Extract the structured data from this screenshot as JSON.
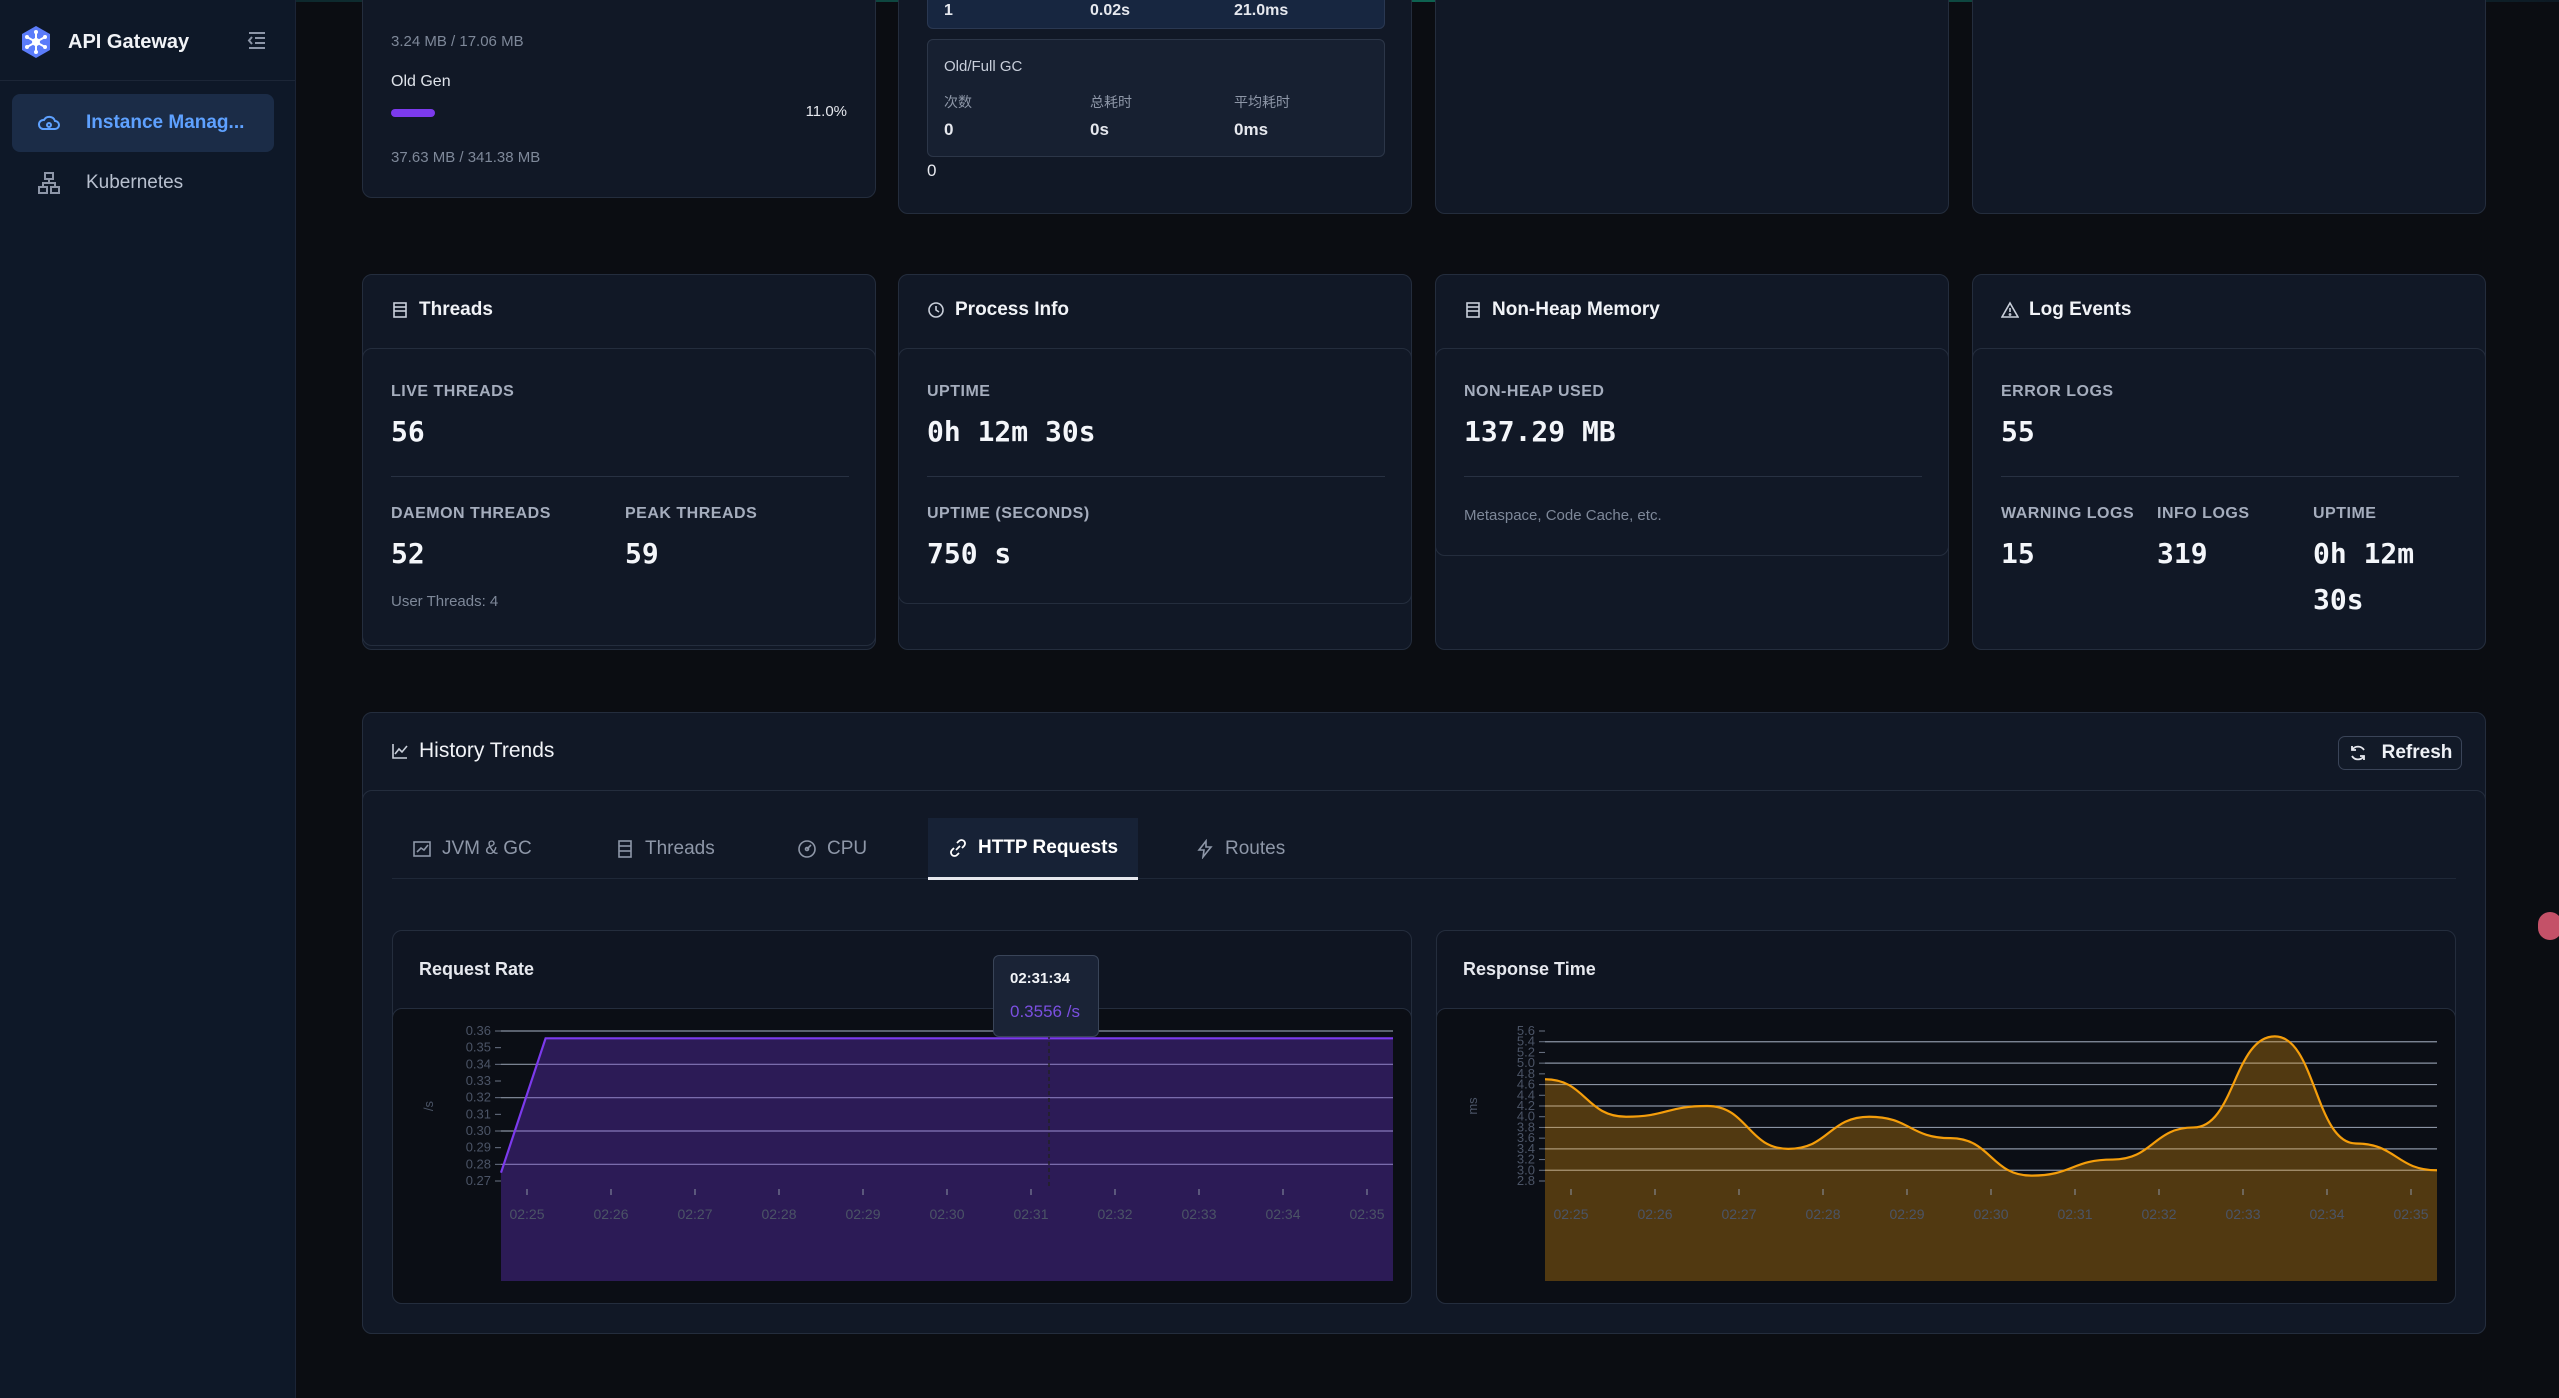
{
  "app": {
    "title": "API Gateway"
  },
  "sidebar": {
    "items": [
      {
        "label": "Instance Manag...",
        "icon": "cloud-gear-icon",
        "active": true
      },
      {
        "label": "Kubernetes",
        "icon": "cluster-icon",
        "active": false
      }
    ]
  },
  "top_partial": {
    "young_mem": "3.24 MB / 17.06 MB",
    "old_gen_label": "Old Gen",
    "old_gen_percent": "11.0%",
    "old_gen_fraction": 0.11,
    "old_gen_mem": "37.63 MB / 341.38 MB",
    "young_gc_row": {
      "count": "1",
      "total": "0.02s",
      "avg": "21.0ms"
    },
    "old_gc": {
      "title": "Old/Full GC",
      "count_label": "次数",
      "total_label": "总耗时",
      "avg_label": "平均耗时",
      "count": "0",
      "total": "0s",
      "avg": "0ms"
    },
    "extra_zero": "0"
  },
  "threads": {
    "title": "Threads",
    "live_label": "LIVE THREADS",
    "live": "56",
    "daemon_label": "DAEMON THREADS",
    "daemon": "52",
    "peak_label": "PEAK THREADS",
    "peak": "59",
    "user_threads": "User Threads: 4"
  },
  "process": {
    "title": "Process Info",
    "uptime_label": "UPTIME",
    "uptime": "0h 12m 30s",
    "uptime_s_label": "UPTIME (SECONDS)",
    "uptime_s": "750 s"
  },
  "nonheap": {
    "title": "Non-Heap Memory",
    "used_label": "NON-HEAP USED",
    "used": "137.29 MB",
    "note": "Metaspace, Code Cache, etc."
  },
  "logs": {
    "title": "Log Events",
    "error_label": "ERROR LOGS",
    "error": "55",
    "warning_label": "WARNING LOGS",
    "warning": "15",
    "info_label": "INFO LOGS",
    "info": "319",
    "uptime_label": "UPTIME",
    "uptime_line1": "0h 12m",
    "uptime_line2": "30s"
  },
  "history": {
    "title": "History Trends",
    "refresh": "Refresh",
    "tabs": [
      {
        "label": "JVM & GC",
        "icon": "chart-line-icon"
      },
      {
        "label": "Threads",
        "icon": "list-icon"
      },
      {
        "label": "CPU",
        "icon": "gauge-icon"
      },
      {
        "label": "HTTP Requests",
        "icon": "link-icon",
        "active": true
      },
      {
        "label": "Routes",
        "icon": "bolt-icon"
      }
    ],
    "tooltip": {
      "time": "02:31:34",
      "value": "0.3556 /s"
    }
  },
  "chart_data": [
    {
      "type": "area",
      "title": "Request Rate",
      "ylabel": "/s",
      "x": [
        "02:25",
        "02:26",
        "02:27",
        "02:28",
        "02:29",
        "02:30",
        "02:31",
        "02:32",
        "02:33",
        "02:34",
        "02:35"
      ],
      "yticks": [
        0.27,
        0.28,
        0.29,
        0.3,
        0.31,
        0.32,
        0.33,
        0.34,
        0.35,
        0.36
      ],
      "ylim": [
        0.27,
        0.36
      ],
      "series": [
        {
          "values": [
            0.275,
            0.3556,
            0.3556,
            0.3556,
            0.3556,
            0.3556,
            0.3556,
            0.3556,
            0.3556,
            0.3556,
            0.3556,
            0.3556
          ]
        }
      ],
      "color": "#7c3aed"
    },
    {
      "type": "area",
      "title": "Response Time",
      "ylabel": "ms",
      "x": [
        "02:25",
        "02:26",
        "02:27",
        "02:28",
        "02:29",
        "02:30",
        "02:31",
        "02:32",
        "02:33",
        "02:34",
        "02:35"
      ],
      "yticks": [
        2.8,
        3.0,
        3.2,
        3.4,
        3.6,
        3.8,
        4.0,
        4.2,
        4.4,
        4.6,
        4.8,
        5.0,
        5.2,
        5.4,
        5.6
      ],
      "ylim": [
        2.8,
        5.6
      ],
      "series": [
        {
          "values": [
            4.7,
            4.0,
            4.2,
            3.4,
            4.0,
            3.6,
            2.9,
            3.2,
            3.8,
            5.5,
            3.5,
            3.0
          ]
        }
      ],
      "color": "#f59e0b"
    }
  ]
}
